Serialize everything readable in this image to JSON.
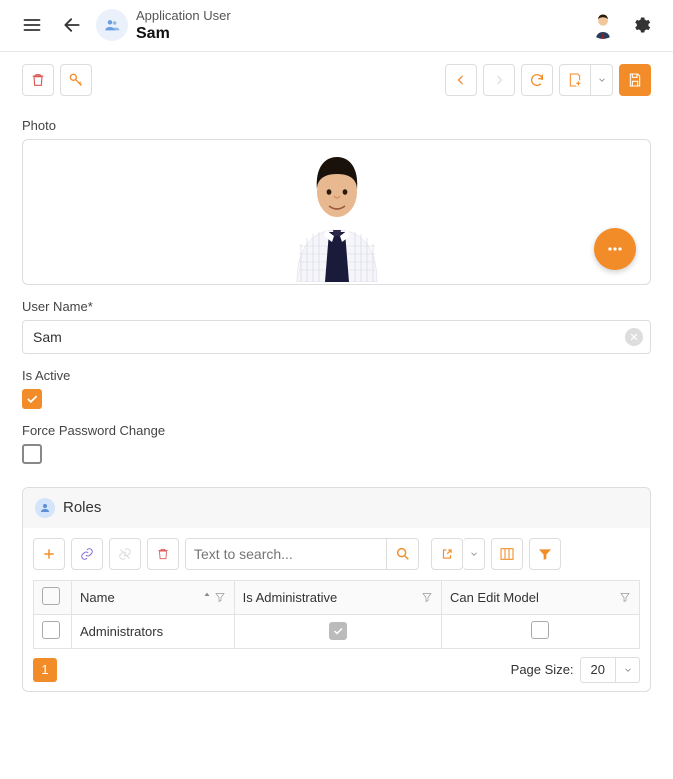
{
  "header": {
    "subtitle": "Application User",
    "title": "Sam"
  },
  "toolbar": {},
  "form": {
    "photo_label": "Photo",
    "username_label": "User Name*",
    "username_value": "Sam",
    "is_active_label": "Is Active",
    "is_active_checked": true,
    "force_pw_label": "Force Password Change",
    "force_pw_checked": false
  },
  "roles": {
    "panel_title": "Roles",
    "search_placeholder": "Text to search...",
    "columns": {
      "name": "Name",
      "is_admin": "Is Administrative",
      "can_edit": "Can Edit Model"
    },
    "rows": [
      {
        "name": "Administrators",
        "is_admin": true,
        "can_edit": false
      }
    ],
    "page_current": "1",
    "page_size_label": "Page Size:",
    "page_size_value": "20"
  }
}
